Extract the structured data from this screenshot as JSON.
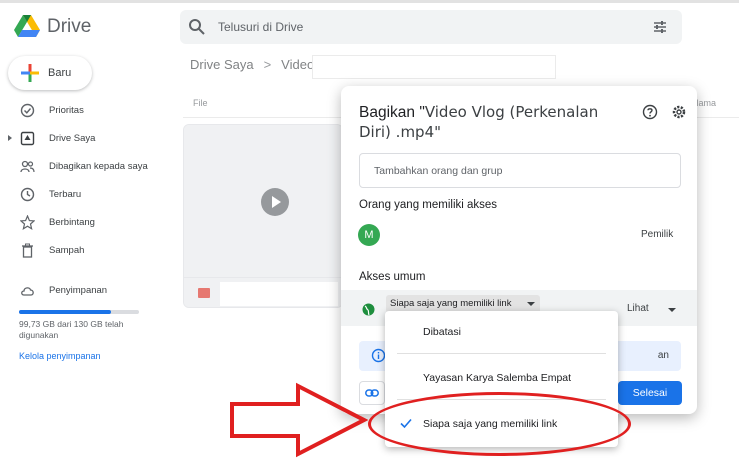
{
  "app": {
    "name": "Drive"
  },
  "search": {
    "placeholder": "Telusuri di Drive"
  },
  "sidebar": {
    "new_label": "Baru",
    "items": [
      {
        "label": "Prioritas",
        "icon": "check-circle-icon"
      },
      {
        "label": "Drive Saya",
        "icon": "my-drive-icon"
      },
      {
        "label": "Dibagikan kepada saya",
        "icon": "people-icon"
      },
      {
        "label": "Terbaru",
        "icon": "clock-icon"
      },
      {
        "label": "Berbintang",
        "icon": "star-icon"
      },
      {
        "label": "Sampah",
        "icon": "trash-icon"
      },
      {
        "label": "Penyimpanan",
        "icon": "cloud-icon"
      }
    ],
    "storage_text": "99,73 GB dari 130 GB telah digunakan",
    "storage_fraction": 0.767,
    "manage_storage": "Kelola penyimpanan"
  },
  "breadcrumb": {
    "root": "Drive Saya",
    "current": "Video"
  },
  "list": {
    "col_file": "File",
    "col_name": "Nama"
  },
  "share_dialog": {
    "title_prefix": "Bagikan \"",
    "title_file_line1": "Video Vlog (Perkenalan",
    "title_file_line2": "Diri) .mp4\"",
    "add_placeholder": "Tambahkan orang dan grup",
    "people_heading": "Orang yang memiliki akses",
    "owner_initial": "M",
    "owner_role": "Pemilik",
    "general_heading": "Akses umum",
    "access_value": "Siapa saja yang memiliki link",
    "role_value": "Lihat",
    "info_text": "an",
    "done_label": "Selesai"
  },
  "access_menu": {
    "options": [
      "Dibatasi",
      "Yayasan Karya Salemba Empat",
      "Siapa saja yang memiliki link"
    ],
    "selected": "Siapa saja yang memiliki link"
  },
  "colors": {
    "accent": "#1a73e8",
    "highlight": "#e02020",
    "owner_avatar": "#34a853"
  }
}
